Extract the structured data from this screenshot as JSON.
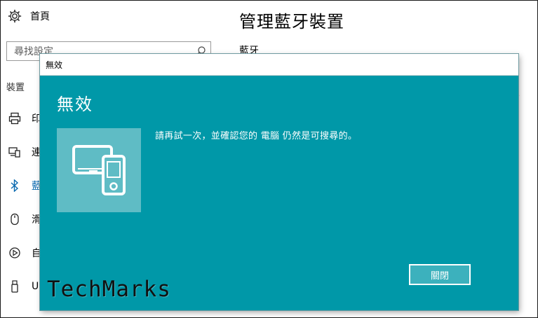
{
  "settings": {
    "home_label": "首頁",
    "search_placeholder": "尋找設定",
    "section_label": "裝置",
    "page_title": "管理藍牙裝置",
    "sub_title": "藍牙",
    "sidebar": {
      "items": [
        {
          "label": "印",
          "icon": "printer-icon"
        },
        {
          "label": "連",
          "icon": "connected-devices-icon"
        },
        {
          "label": "藍",
          "icon": "bluetooth-icon"
        },
        {
          "label": "滑",
          "icon": "mouse-icon"
        },
        {
          "label": "自",
          "icon": "autoplay-icon"
        },
        {
          "label": "U",
          "icon": "usb-icon"
        }
      ]
    },
    "partial_text": "."
  },
  "dialog": {
    "window_title": "無效",
    "heading": "無效",
    "message": "請再試一次，並確認您的 電腦 仍然是可搜尋的。",
    "close_label": "關閉",
    "tile_icon": "devices-icon"
  },
  "watermark": {
    "text": "TechMarks"
  },
  "colors": {
    "dialog_bg": "#0098a8",
    "tile_bg": "#5fbcc5",
    "button_bg": "#3cb1bd",
    "accent_blue": "#0b6ab0"
  }
}
